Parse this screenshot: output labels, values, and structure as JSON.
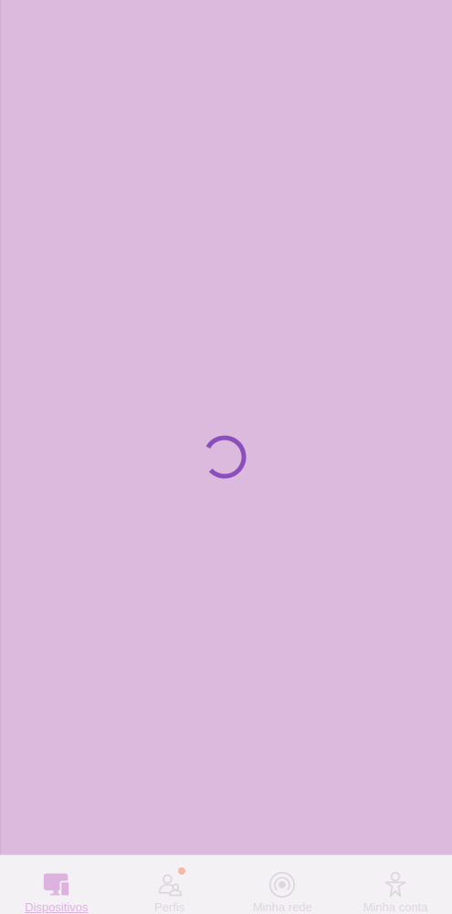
{
  "screen": {
    "state": "loading",
    "overlay_color": "#dcbade",
    "spinner_color": "#8b4fbc",
    "spinner": "loading-spinner"
  },
  "tabbar": {
    "active_color": "#dcb2df",
    "inactive_color": "#ddd6df",
    "badge_color": "#f4b9a7",
    "tabs": [
      {
        "label": "Dispositivos",
        "icon": "devices-icon",
        "active": true
      },
      {
        "label": "Perfis",
        "icon": "profiles-icon",
        "active": false,
        "badge": true
      },
      {
        "label": "Minha rede",
        "icon": "network-icon",
        "active": false
      },
      {
        "label": "Minha conta",
        "icon": "account-icon",
        "active": false
      }
    ]
  }
}
